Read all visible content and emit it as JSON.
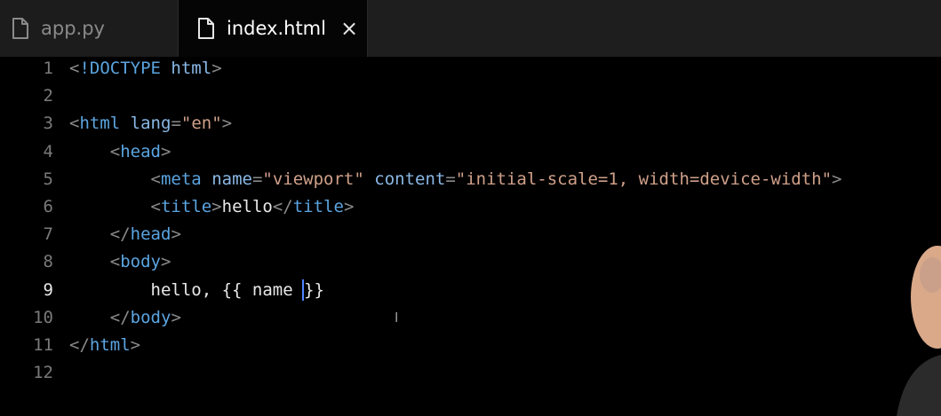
{
  "tabs": [
    {
      "label": "app.py",
      "icon": "file-icon",
      "active": false
    },
    {
      "label": "index.html",
      "icon": "file-icon",
      "active": true,
      "close": "×"
    }
  ],
  "editor": {
    "current_line": 9,
    "line_numbers": [
      "1",
      "2",
      "3",
      "4",
      "5",
      "6",
      "7",
      "8",
      "9",
      "10",
      "11",
      "12"
    ],
    "lines": [
      "<!DOCTYPE html>",
      "",
      "<html lang=\"en\">",
      "    <head>",
      "        <meta name=\"viewport\" content=\"initial-scale=1, width=device-width\">",
      "        <title>hello</title>",
      "    </head>",
      "    <body>",
      "        hello, {{ name }}",
      "    </body>",
      "</html>",
      ""
    ]
  },
  "colors": {
    "tag": "#5ba4e0",
    "attribute": "#8ab8e6",
    "string": "#cfa08a",
    "bracket": "#8a8a8a",
    "cursor": "#4f83ff"
  }
}
